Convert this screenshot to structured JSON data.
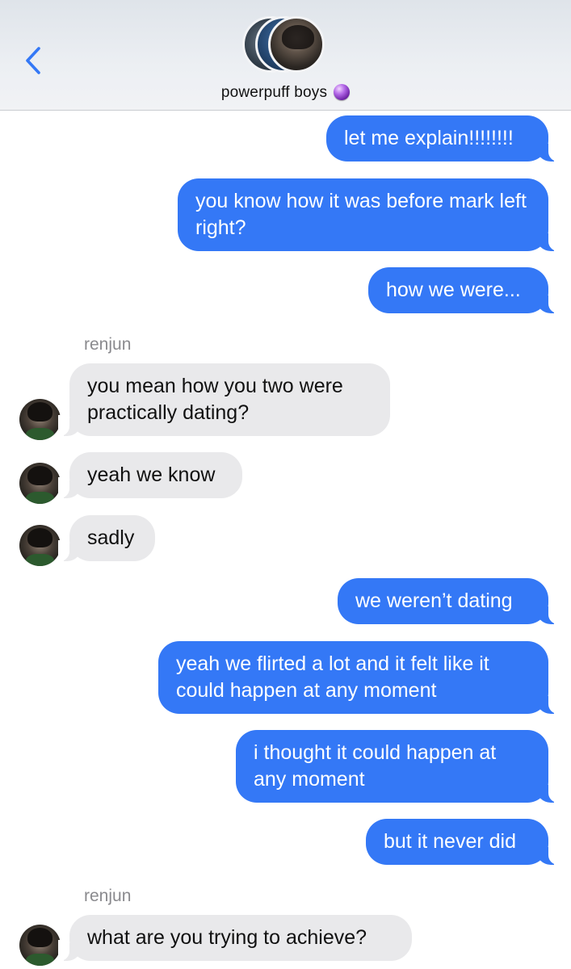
{
  "header": {
    "group_name": "powerpuff boys",
    "group_emoji": "crystal-ball-icon",
    "back_icon": "chevron-left-icon"
  },
  "colors": {
    "outgoing_bubble": "#3478f6",
    "incoming_bubble": "#e9e9eb",
    "accent": "#3478f6"
  },
  "messages": [
    {
      "from": "me",
      "text": "let me explain!!!!!!!!"
    },
    {
      "from": "me",
      "text": "you know how it was before mark left right?"
    },
    {
      "from": "me",
      "text": "how we were..."
    },
    {
      "from": "renjun",
      "sender_label": "renjun",
      "text": "you mean how you two were practically dating?"
    },
    {
      "from": "renjun",
      "text": "yeah we know"
    },
    {
      "from": "renjun",
      "text": "sadly"
    },
    {
      "from": "me",
      "text": "we weren’t dating"
    },
    {
      "from": "me",
      "text": "yeah we flirted a lot and it felt like it could happen at any moment"
    },
    {
      "from": "me",
      "text": "i thought it could happen at any moment"
    },
    {
      "from": "me",
      "text": "but it never did"
    },
    {
      "from": "renjun",
      "sender_label": "renjun",
      "text": "what are you trying to achieve?"
    }
  ]
}
